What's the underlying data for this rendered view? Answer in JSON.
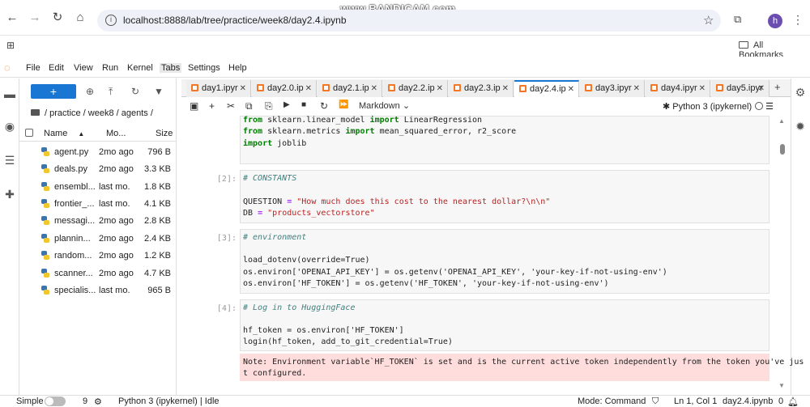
{
  "browser": {
    "url": "localhost:8888/lab/tree/practice/week8/day2.4.ipynb",
    "watermark": "www.BANDICAM.com",
    "bookmarks_label": "All Bookmarks",
    "avatar_letter": "h"
  },
  "menu": {
    "items": [
      "File",
      "Edit",
      "View",
      "Run",
      "Kernel",
      "Tabs",
      "Settings",
      "Help"
    ]
  },
  "filebrowser": {
    "new_label": "+",
    "breadcrumb": "/ practice / week8 / agents /",
    "headers": {
      "name": "Name",
      "modified": "Mo...",
      "size": "Size"
    },
    "files": [
      {
        "name": "agent.py",
        "modified": "2mo ago",
        "size": "796 B"
      },
      {
        "name": "deals.py",
        "modified": "2mo ago",
        "size": "3.3 KB"
      },
      {
        "name": "ensembl...",
        "modified": "last mo.",
        "size": "1.8 KB"
      },
      {
        "name": "frontier_...",
        "modified": "last mo.",
        "size": "4.1 KB"
      },
      {
        "name": "messagi...",
        "modified": "2mo ago",
        "size": "2.8 KB"
      },
      {
        "name": "plannin...",
        "modified": "2mo ago",
        "size": "2.4 KB"
      },
      {
        "name": "random...",
        "modified": "2mo ago",
        "size": "1.2 KB"
      },
      {
        "name": "scanner...",
        "modified": "2mo ago",
        "size": "4.7 KB"
      },
      {
        "name": "specialis...",
        "modified": "last mo.",
        "size": "965 B"
      }
    ]
  },
  "tabs": [
    {
      "label": "day1.ipyr",
      "active": false
    },
    {
      "label": "day2.0.ip",
      "active": false
    },
    {
      "label": "day2.1.ip",
      "active": false
    },
    {
      "label": "day2.2.ip",
      "active": false
    },
    {
      "label": "day2.3.ip",
      "active": false
    },
    {
      "label": "day2.4.ip",
      "active": true
    },
    {
      "label": "day3.ipyr",
      "active": false
    },
    {
      "label": "day4.ipyr",
      "active": false
    },
    {
      "label": "day5.ipyr",
      "active": false
    }
  ],
  "toolbar": {
    "cell_type": "Markdown",
    "kernel": "Python 3 (ipykernel)"
  },
  "cells": {
    "c0": {
      "line1": "from sklearn.linear_model import LinearRegression",
      "line2": "from sklearn.metrics import mean_squared_error, r2_score",
      "line3": "import joblib"
    },
    "c2": {
      "prompt": "[2]:",
      "comment": "# CONSTANTS",
      "q_name": "QUESTION",
      "q_val": "\"How much does this cost to the nearest dollar?\\n\\n\"",
      "db_name": "DB",
      "db_val": "\"products_vectorstore\""
    },
    "c3": {
      "prompt": "[3]:",
      "comment": "# environment",
      "line1": "load_dotenv(override=True)",
      "line2": "os.environ['OPENAI_API_KEY'] = os.getenv('OPENAI_API_KEY', 'your-key-if-not-using-env')",
      "line3": "os.environ['HF_TOKEN'] = os.getenv('HF_TOKEN', 'your-key-if-not-using-env')"
    },
    "c4": {
      "prompt": "[4]:",
      "comment": "# Log in to HuggingFace",
      "line1": "hf_token = os.environ['HF_TOKEN']",
      "line2": "login(hf_token, add_to_git_credential=True)",
      "stderr": "Note: Environment variable`HF_TOKEN` is set and is the current active token independently from the token you've jus\nt configured."
    }
  },
  "status": {
    "mode_label": "Simple",
    "count": "9",
    "kernel_status": "Python 3 (ipykernel) | Idle",
    "mode": "Mode: Command",
    "position": "Ln 1, Col 1",
    "file": "day2.4.ipynb",
    "notifications": "0"
  }
}
